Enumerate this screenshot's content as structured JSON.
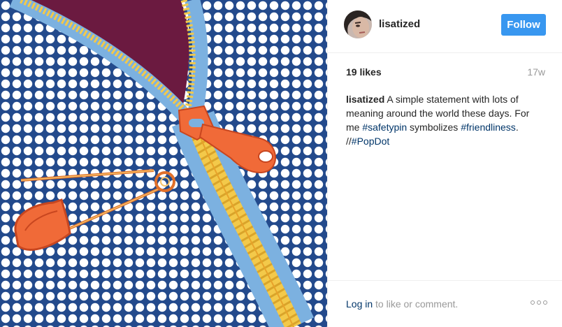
{
  "post": {
    "image": {
      "description_icons": [
        "zipper-icon",
        "safety-pin-icon"
      ],
      "colors": {
        "background_blue": "#234a8c",
        "dot_white": "#ffffff",
        "maroon": "#6b1a40",
        "zipper_tape": "#7cb1e0",
        "zipper_teeth": "#f3c94a",
        "pull_orange": "#f06a38"
      }
    },
    "header": {
      "username": "lisatized",
      "follow_label": "Follow"
    },
    "stats": {
      "likes": "19 likes",
      "age": "17w"
    },
    "caption": {
      "user": "lisatized",
      "text_1": " A simple statement with lots of meaning around the world these days. For me ",
      "tag_1": "#safetypin",
      "text_2": " symbolizes ",
      "tag_2": "#friendliness",
      "text_3": ". //",
      "tag_3": "#PopDot"
    },
    "footer": {
      "login_label": "Log in",
      "login_suffix": " to like or comment.",
      "more_icon": "more-options-icon"
    }
  }
}
